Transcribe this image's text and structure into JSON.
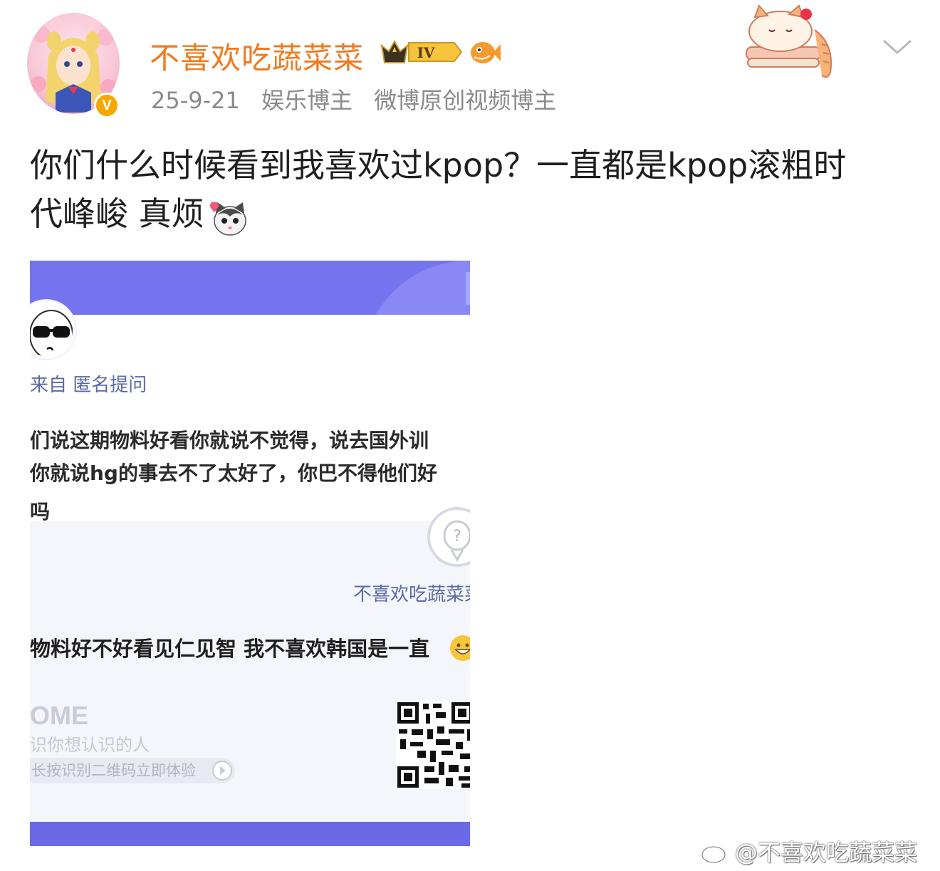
{
  "header": {
    "username": "不喜欢吃蔬菜菜",
    "verified_badge": "V",
    "level_badge": "IV",
    "date": "25-9-21",
    "category": "娱乐博主",
    "certification": "微博原创视频博主",
    "more_icon": "chevron-down-icon"
  },
  "post": {
    "text_line1": "你们什么时候看到我喜欢过kpop？一直都是kpop滚粗时",
    "text_line2": "代峰峻 真烦"
  },
  "screenshot": {
    "from_label": "来自 匿名提问",
    "question_line1": "们说这期物料好看你就说不觉得，说去国外训",
    "question_line2": "你就说hg的事去不了太好了，你巴不得他们好",
    "question_line3": "吗",
    "answerer_name": "不喜欢吃蔬菜菜",
    "answer": "物料好不好看见仁见智 我不喜欢韩国是一直",
    "brand": "OME",
    "brand_tagline": "识你想认识的人",
    "brand_cta": "长按识别二维码立即体验"
  },
  "watermark": "@不喜欢吃蔬菜菜",
  "colors": {
    "username": "#ef7a1f",
    "meta": "#8a8a8a",
    "banner": "#7474ee",
    "link_blue": "#5a6aa8"
  }
}
